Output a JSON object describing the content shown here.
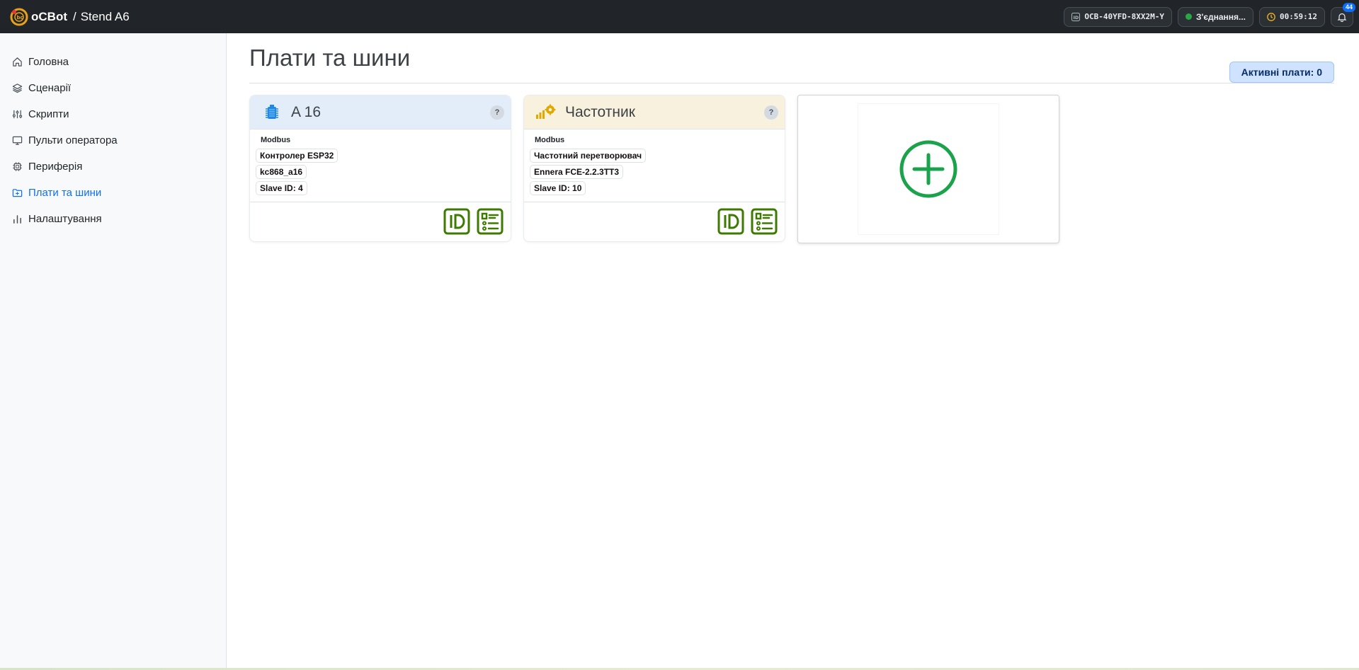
{
  "header": {
    "brand": "oCBot",
    "separator": "/",
    "project": "Stend A6",
    "device_id": "OCB-40YFD-8XX2M-Y",
    "connection_status": "З'єднання...",
    "timer": "00:59:12",
    "notifications_count": "44"
  },
  "sidebar": {
    "items": [
      {
        "label": "Головна",
        "icon": "home-icon"
      },
      {
        "label": "Сценарії",
        "icon": "layers-icon"
      },
      {
        "label": "Скрипти",
        "icon": "sliders-icon"
      },
      {
        "label": "Пульти оператора",
        "icon": "monitor-icon"
      },
      {
        "label": "Периферія",
        "icon": "chip-icon"
      },
      {
        "label": "Плати та шини",
        "icon": "board-icon",
        "active": true
      },
      {
        "label": "Налаштування",
        "icon": "bar-chart-icon"
      }
    ]
  },
  "main": {
    "title": "Плати та шини",
    "active_boards_label": "Активні плати: 0",
    "cards": [
      {
        "title": "A 16",
        "protocol": "Modbus",
        "tags": [
          "Контролер ESP32",
          "kc868_a16",
          "Slave ID: 4"
        ],
        "help": "?",
        "header_color": "#e3edf9"
      },
      {
        "title": "Частотник",
        "protocol": "Modbus",
        "tags": [
          "Частотний перетворювач",
          "Ennera FCE-2.2.3TT3",
          "Slave ID: 10"
        ],
        "help": "?",
        "header_color": "#f8f1de"
      }
    ]
  },
  "colors": {
    "accent": "#0d6efd",
    "action_green": "#3d7a00",
    "add_green": "#1aa34a",
    "topbar": "#212529"
  }
}
